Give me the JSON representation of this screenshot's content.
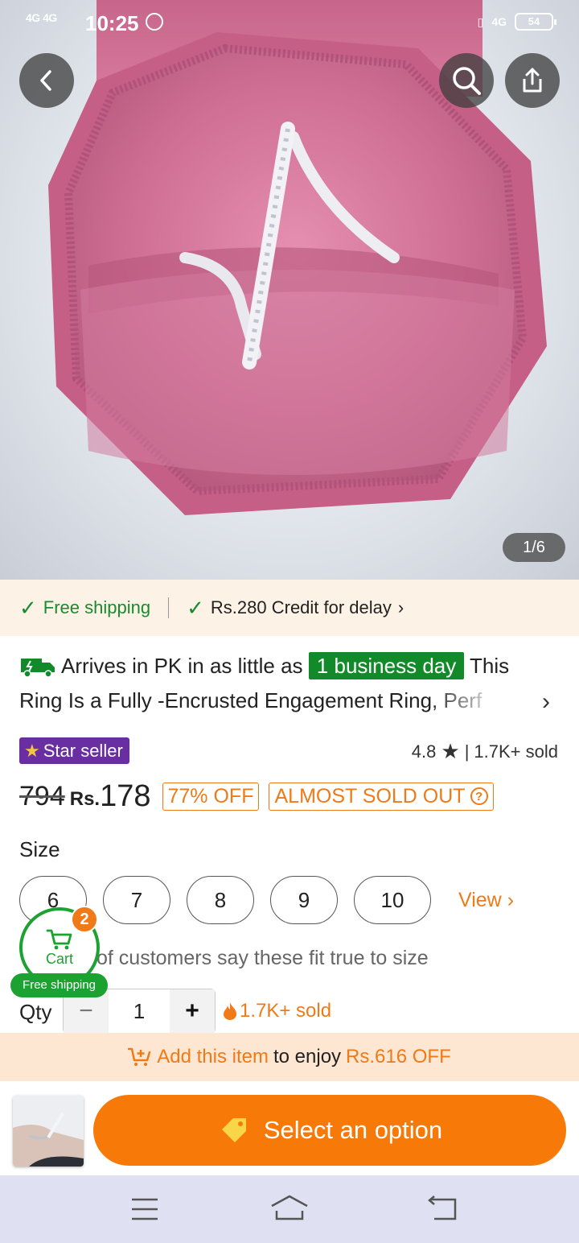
{
  "status_bar": {
    "signal": "4G 4G",
    "time": "10:25",
    "network": "4G",
    "battery": "54"
  },
  "gallery": {
    "counter": "1/6"
  },
  "shipping_bar": {
    "free_shipping": "Free shipping",
    "credit": "Rs.280 Credit for delay"
  },
  "product": {
    "arrival_prefix": "Arrives in PK in as little as",
    "arrival_badge": "1 business day",
    "title_line1_tail": "This",
    "title_line2": "Ring Is a Fully -Encrusted Engagement Ring, Perf",
    "star_seller": "Star seller",
    "rating": "4.8",
    "sold": "1.7K+ sold",
    "old_price": "794",
    "currency": "Rs.",
    "price": "178",
    "discount": "77% OFF",
    "stock_tag": "ALMOST SOLD OUT"
  },
  "size": {
    "label": "Size",
    "options": [
      "6",
      "7",
      "8",
      "9",
      "10"
    ],
    "view_label": "View",
    "fit_text": "of customers say these fit true to size"
  },
  "quantity": {
    "label": "Qty",
    "value": "1",
    "hot_sold": "1.7K+ sold"
  },
  "cart": {
    "label": "Cart",
    "count": "2",
    "free_shipping": "Free shipping"
  },
  "promo": {
    "add_item": "Add this item",
    "middle": "to enjoy",
    "discount": "Rs.616 OFF"
  },
  "action": {
    "select_label": "Select an option"
  },
  "colors": {
    "accent": "#f77a08",
    "green": "#1a8a2f",
    "star_seller": "#6a2ea3"
  }
}
